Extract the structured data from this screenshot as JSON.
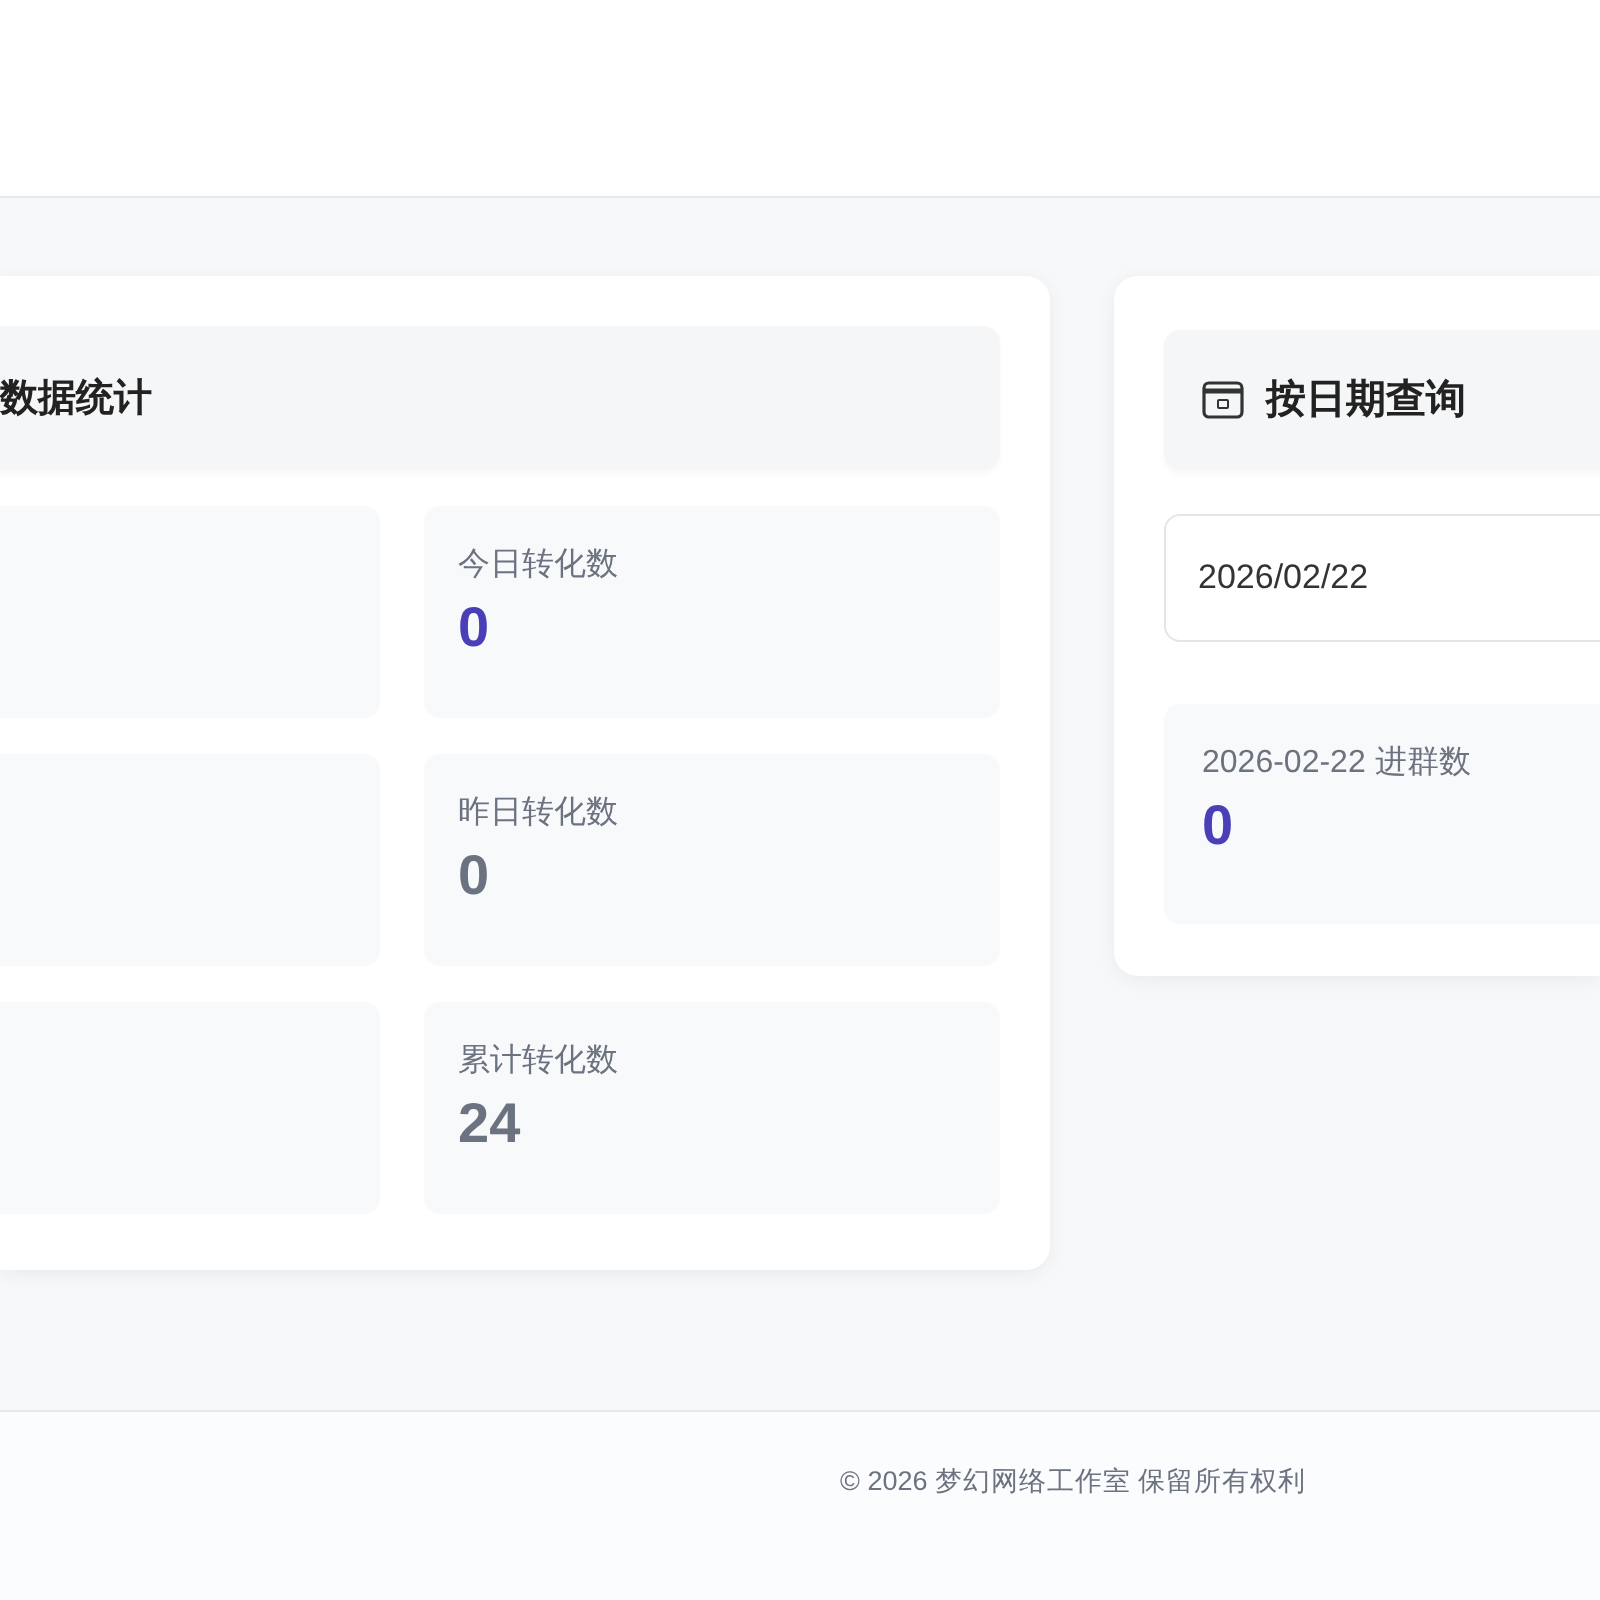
{
  "stats_panel": {
    "title": "数据统计",
    "stats": [
      {
        "label": "今日转化数",
        "value": "0",
        "highlighted": true
      },
      {
        "label": "昨日转化数",
        "value": "0",
        "highlighted": false
      },
      {
        "label": "累计转化数",
        "value": "24",
        "highlighted": false
      }
    ]
  },
  "date_query": {
    "title": "按日期查询",
    "date_input": {
      "value": "2026/02/22"
    },
    "result": {
      "label": "2026-02-22 进群数",
      "value": "0",
      "highlighted": true
    }
  },
  "footer": {
    "text": "© 2026 梦幻网络工作室 保留所有权利"
  }
}
